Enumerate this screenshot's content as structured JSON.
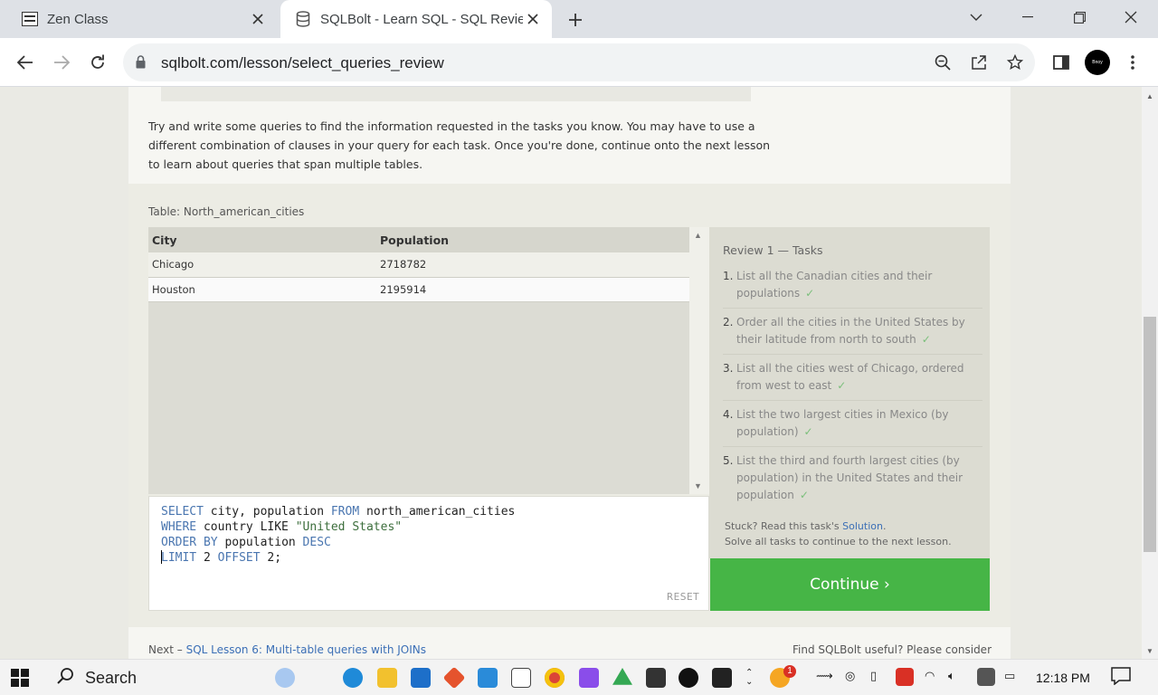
{
  "browser": {
    "tabs": [
      {
        "title": "Zen Class",
        "active": false
      },
      {
        "title": "SQLBolt - Learn SQL - SQL Revie",
        "active": true
      }
    ],
    "url": "sqlbolt.com/lesson/select_queries_review",
    "profile_label": "Bnoy"
  },
  "lesson": {
    "intro": "Try and write some queries to find the information requested in the tasks you know. You may have to use a different combination of clauses in your query for each task. Once you're done, continue onto the next lesson to learn about queries that span multiple tables.",
    "table_caption": "Table: North_american_cities",
    "columns": [
      "City",
      "Population"
    ],
    "rows": [
      {
        "city": "Chicago",
        "population": "2718782"
      },
      {
        "city": "Houston",
        "population": "2195914"
      }
    ],
    "query": {
      "line1": {
        "kw1": "SELECT",
        "t1": " city, population ",
        "kw2": "FROM",
        "t2": " north_american_cities"
      },
      "line2": {
        "kw1": "WHERE",
        "t1": " country LIKE ",
        "str": "\"United States\""
      },
      "line3": {
        "kw1": "ORDER BY",
        "t1": " population ",
        "kw2": "DESC"
      },
      "line4": {
        "kw1": "LIMIT",
        "t1": " 2 ",
        "kw2": "OFFSET",
        "t2": " 2;"
      }
    },
    "reset_label": "RESET",
    "tasks_title": "Review 1 — Tasks",
    "tasks": [
      {
        "num": "1.",
        "text": "List all the Canadian cities and their populations"
      },
      {
        "num": "2.",
        "text": "Order all the cities in the United States by their latitude from north to south"
      },
      {
        "num": "3.",
        "text": "List all the cities west of Chicago, ordered from west to east"
      },
      {
        "num": "4.",
        "text": "List the two largest cities in Mexico (by population)"
      },
      {
        "num": "5.",
        "text": "List the third and fourth largest cities (by population) in the United States and their population"
      }
    ],
    "check_mark": "✓",
    "stuck_text": "Stuck? Read this task's ",
    "solution_link": "Solution",
    "stuck_line2": "Solve all tasks to continue to the next lesson.",
    "continue_label": "Continue ›",
    "next_prefix": "Next – ",
    "next_link": "SQL Lesson 6: Multi-table queries with JOINs",
    "useful_text": "Find SQLBolt useful? Please consider"
  },
  "taskbar": {
    "search_label": "Search",
    "time": "12:18 PM",
    "notification_count": "1"
  }
}
